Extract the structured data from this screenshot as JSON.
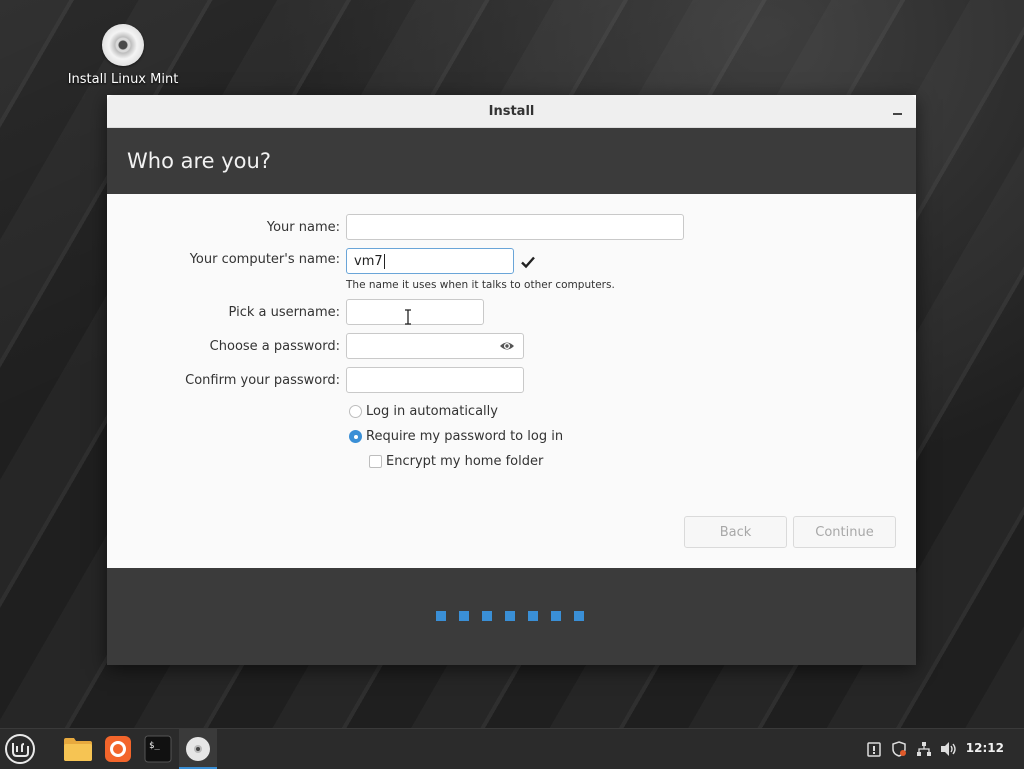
{
  "desktop": {
    "icon_label": "Install Linux Mint"
  },
  "window": {
    "title": "Install",
    "header_title": "Who are you?"
  },
  "form": {
    "your_name_label": "Your name:",
    "your_name_value": "",
    "computer_name_label": "Your computer's name:",
    "computer_name_value": "vm7",
    "computer_name_hint": "The name it uses when it talks to other computers.",
    "username_label": "Pick a username:",
    "username_value": "",
    "password_label": "Choose a password:",
    "password_value": "",
    "confirm_label": "Confirm your password:",
    "confirm_value": "",
    "login_auto_label": "Log in automatically",
    "login_auto_selected": false,
    "require_password_label": "Require my password to log in",
    "require_password_selected": true,
    "encrypt_label": "Encrypt my home folder",
    "encrypt_checked": false
  },
  "buttons": {
    "back": "Back",
    "continue": "Continue"
  },
  "progress": {
    "steps": 7
  },
  "taskbar": {
    "items": [
      "mint-menu-icon",
      "files-icon",
      "firefox-icon",
      "terminal-icon",
      "install-disc-icon"
    ],
    "clock": "12:12"
  },
  "colors": {
    "accent": "#3a8fd6",
    "header_bg": "#3b3b3b",
    "window_bg": "#fafafa"
  }
}
